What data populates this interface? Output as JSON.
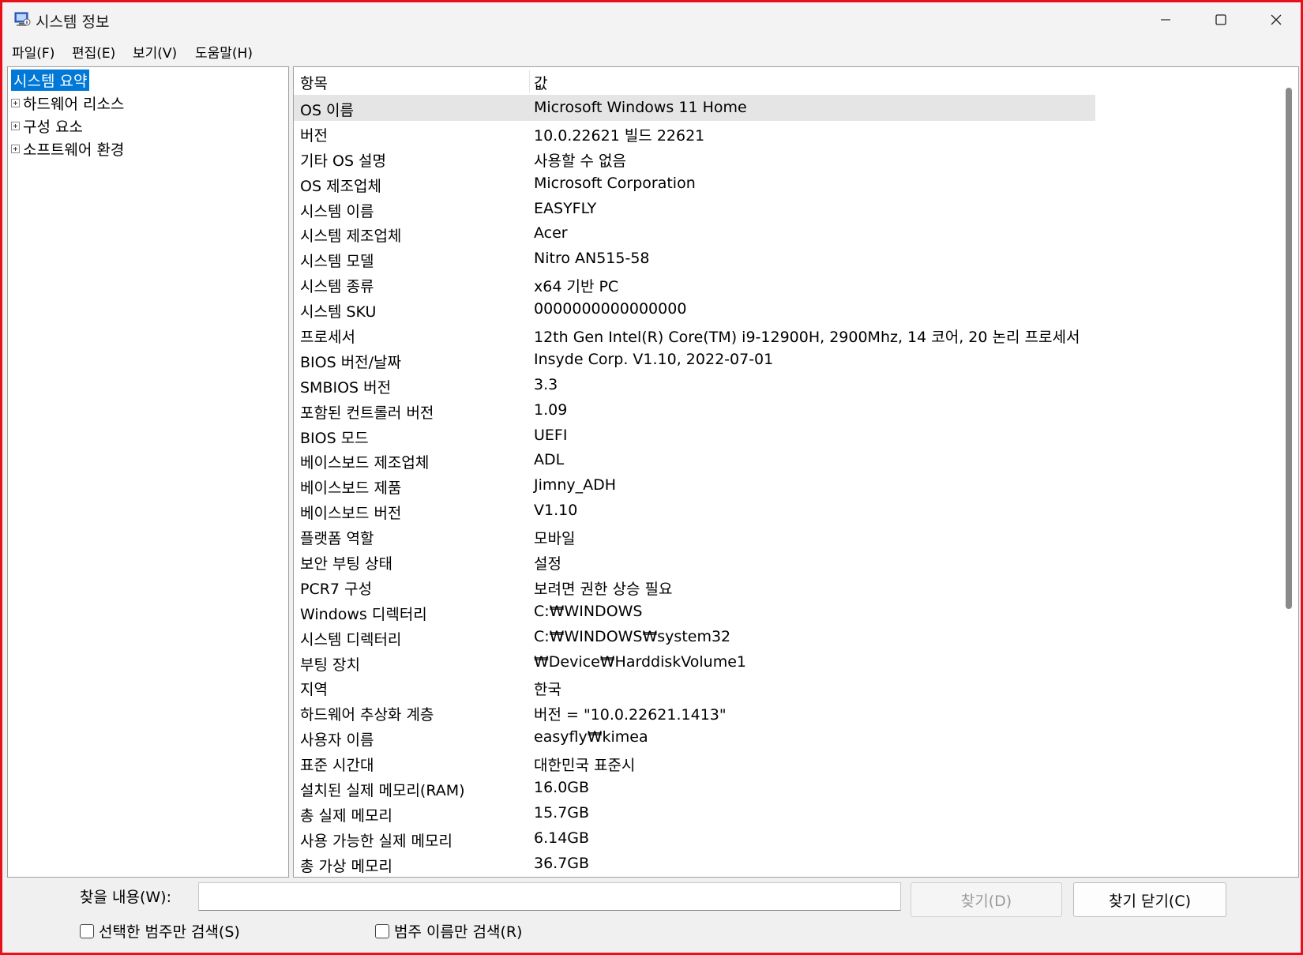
{
  "window": {
    "title": "시스템 정보"
  },
  "icons": {
    "app": "system-info-icon",
    "minimize": "minimize-icon",
    "maximize": "maximize-icon",
    "close": "close-icon"
  },
  "menu": [
    "파일(F)",
    "편집(E)",
    "보기(V)",
    "도움말(H)"
  ],
  "tree": {
    "items": [
      {
        "label": "시스템 요약",
        "selected": true,
        "expandable": false
      },
      {
        "label": "하드웨어 리소스",
        "selected": false,
        "expandable": true
      },
      {
        "label": "구성 요소",
        "selected": false,
        "expandable": true
      },
      {
        "label": "소프트웨어 환경",
        "selected": false,
        "expandable": true
      }
    ]
  },
  "table": {
    "headers": [
      "항목",
      "값"
    ],
    "rows": [
      [
        "OS 이름",
        "Microsoft Windows 11 Home"
      ],
      [
        "버전",
        "10.0.22621 빌드 22621"
      ],
      [
        "기타 OS 설명",
        "사용할 수 없음"
      ],
      [
        "OS 제조업체",
        "Microsoft Corporation"
      ],
      [
        "시스템 이름",
        "EASYFLY"
      ],
      [
        "시스템 제조업체",
        "Acer"
      ],
      [
        "시스템 모델",
        "Nitro AN515-58"
      ],
      [
        "시스템 종류",
        "x64 기반 PC"
      ],
      [
        "시스템 SKU",
        "0000000000000000"
      ],
      [
        "프로세서",
        "12th Gen Intel(R) Core(TM) i9-12900H, 2900Mhz, 14 코어, 20 논리 프로세서"
      ],
      [
        "BIOS 버전/날짜",
        "Insyde Corp. V1.10, 2022-07-01"
      ],
      [
        "SMBIOS 버전",
        "3.3"
      ],
      [
        "포함된 컨트롤러 버전",
        "1.09"
      ],
      [
        "BIOS 모드",
        "UEFI"
      ],
      [
        "베이스보드 제조업체",
        "ADL"
      ],
      [
        "베이스보드 제품",
        "Jimny_ADH"
      ],
      [
        "베이스보드 버전",
        "V1.10"
      ],
      [
        "플랫폼 역할",
        "모바일"
      ],
      [
        "보안 부팅 상태",
        "설정"
      ],
      [
        "PCR7 구성",
        "보려면 권한 상승 필요"
      ],
      [
        "Windows 디렉터리",
        "C:₩WINDOWS"
      ],
      [
        "시스템 디렉터리",
        "C:₩WINDOWS₩system32"
      ],
      [
        "부팅 장치",
        "₩Device₩HarddiskVolume1"
      ],
      [
        "지역",
        "한국"
      ],
      [
        "하드웨어 추상화 계층",
        "버전 = \"10.0.22621.1413\""
      ],
      [
        "사용자 이름",
        "easyfly₩kimea"
      ],
      [
        "표준 시간대",
        "대한민국 표준시"
      ],
      [
        "설치된 실제 메모리(RAM)",
        "16.0GB"
      ],
      [
        "총 실제 메모리",
        "15.7GB"
      ],
      [
        "사용 가능한 실제 메모리",
        "6.14GB"
      ],
      [
        "총 가상 메모리",
        "36.7GB"
      ]
    ],
    "selected_row": 0
  },
  "search": {
    "label": "찾을 내용(W):",
    "value": "",
    "find_button": "찾기(D)",
    "close_button": "찾기 닫기(C)",
    "check_selected_only": "선택한 범주만 검색(S)",
    "check_names_only": "범주 이름만 검색(R)"
  },
  "colors": {
    "frame_border": "#e8101a",
    "selection": "#0078d7"
  }
}
